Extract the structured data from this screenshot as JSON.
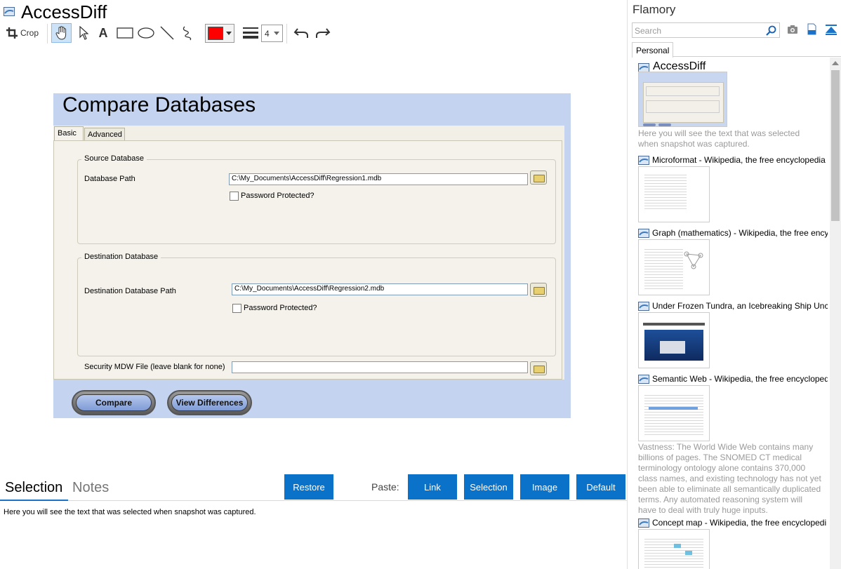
{
  "document": {
    "title": "AccessDiff"
  },
  "toolbar": {
    "crop_label": "Crop",
    "line_width": "4",
    "color": "#ff0000"
  },
  "snapshot": {
    "heading": "Compare Databases",
    "tabs": [
      "Basic",
      "Advanced"
    ],
    "source_group": "Source Database",
    "source_path_label": "Database Path",
    "source_path_value": "C:\\My_Documents\\AccessDiff\\Regression1.mdb",
    "source_password_label": "Password Protected?",
    "dest_group": "Destination Database",
    "dest_path_label": "Destination Database Path",
    "dest_path_value": "C:\\My_Documents\\AccessDiff\\Regression2.mdb",
    "dest_password_label": "Password Protected?",
    "security_label": "Security MDW File (leave blank for none)",
    "security_value": "",
    "compare_button": "Compare",
    "view_button": "View Differences"
  },
  "bottom": {
    "tab_selection": "Selection",
    "tab_notes": "Notes",
    "restore": "Restore",
    "paste_label": "Paste:",
    "paste_link": "Link",
    "paste_selection": "Selection",
    "paste_image": "Image",
    "paste_default": "Default",
    "selection_text": "Here you will see the text that was selected when snapshot was captured."
  },
  "sidebar": {
    "app_title": "Flamory",
    "search_placeholder": "Search",
    "tab_personal": "Personal",
    "entries": [
      {
        "title": "AccessDiff",
        "desc": "Here you will see the text that was selected when snapshot was captured."
      },
      {
        "title": "Microformat - Wikipedia, the free encyclopedia",
        "desc": ""
      },
      {
        "title": "Graph (mathematics) - Wikipedia, the free ency",
        "desc": ""
      },
      {
        "title": "Under Frozen Tundra, an Icebreaking Ship Unco",
        "desc": ""
      },
      {
        "title": "Semantic Web - Wikipedia, the free encycloped",
        "desc": "Vastness: The World Wide Web contains many billions of pages. The SNOMED CT medical terminology ontology alone contains 370,000 class names, and existing technology has not yet been able to eliminate all semantically duplicated terms. Any automated reasoning system will have to deal with truly huge inputs."
      },
      {
        "title": "Concept map - Wikipedia, the free encyclopedi",
        "desc": ""
      }
    ]
  },
  "colors": {
    "accent": "#0a73c9",
    "snapshot_bg": "#c3d3f0",
    "pen_color": "#ff0000"
  }
}
